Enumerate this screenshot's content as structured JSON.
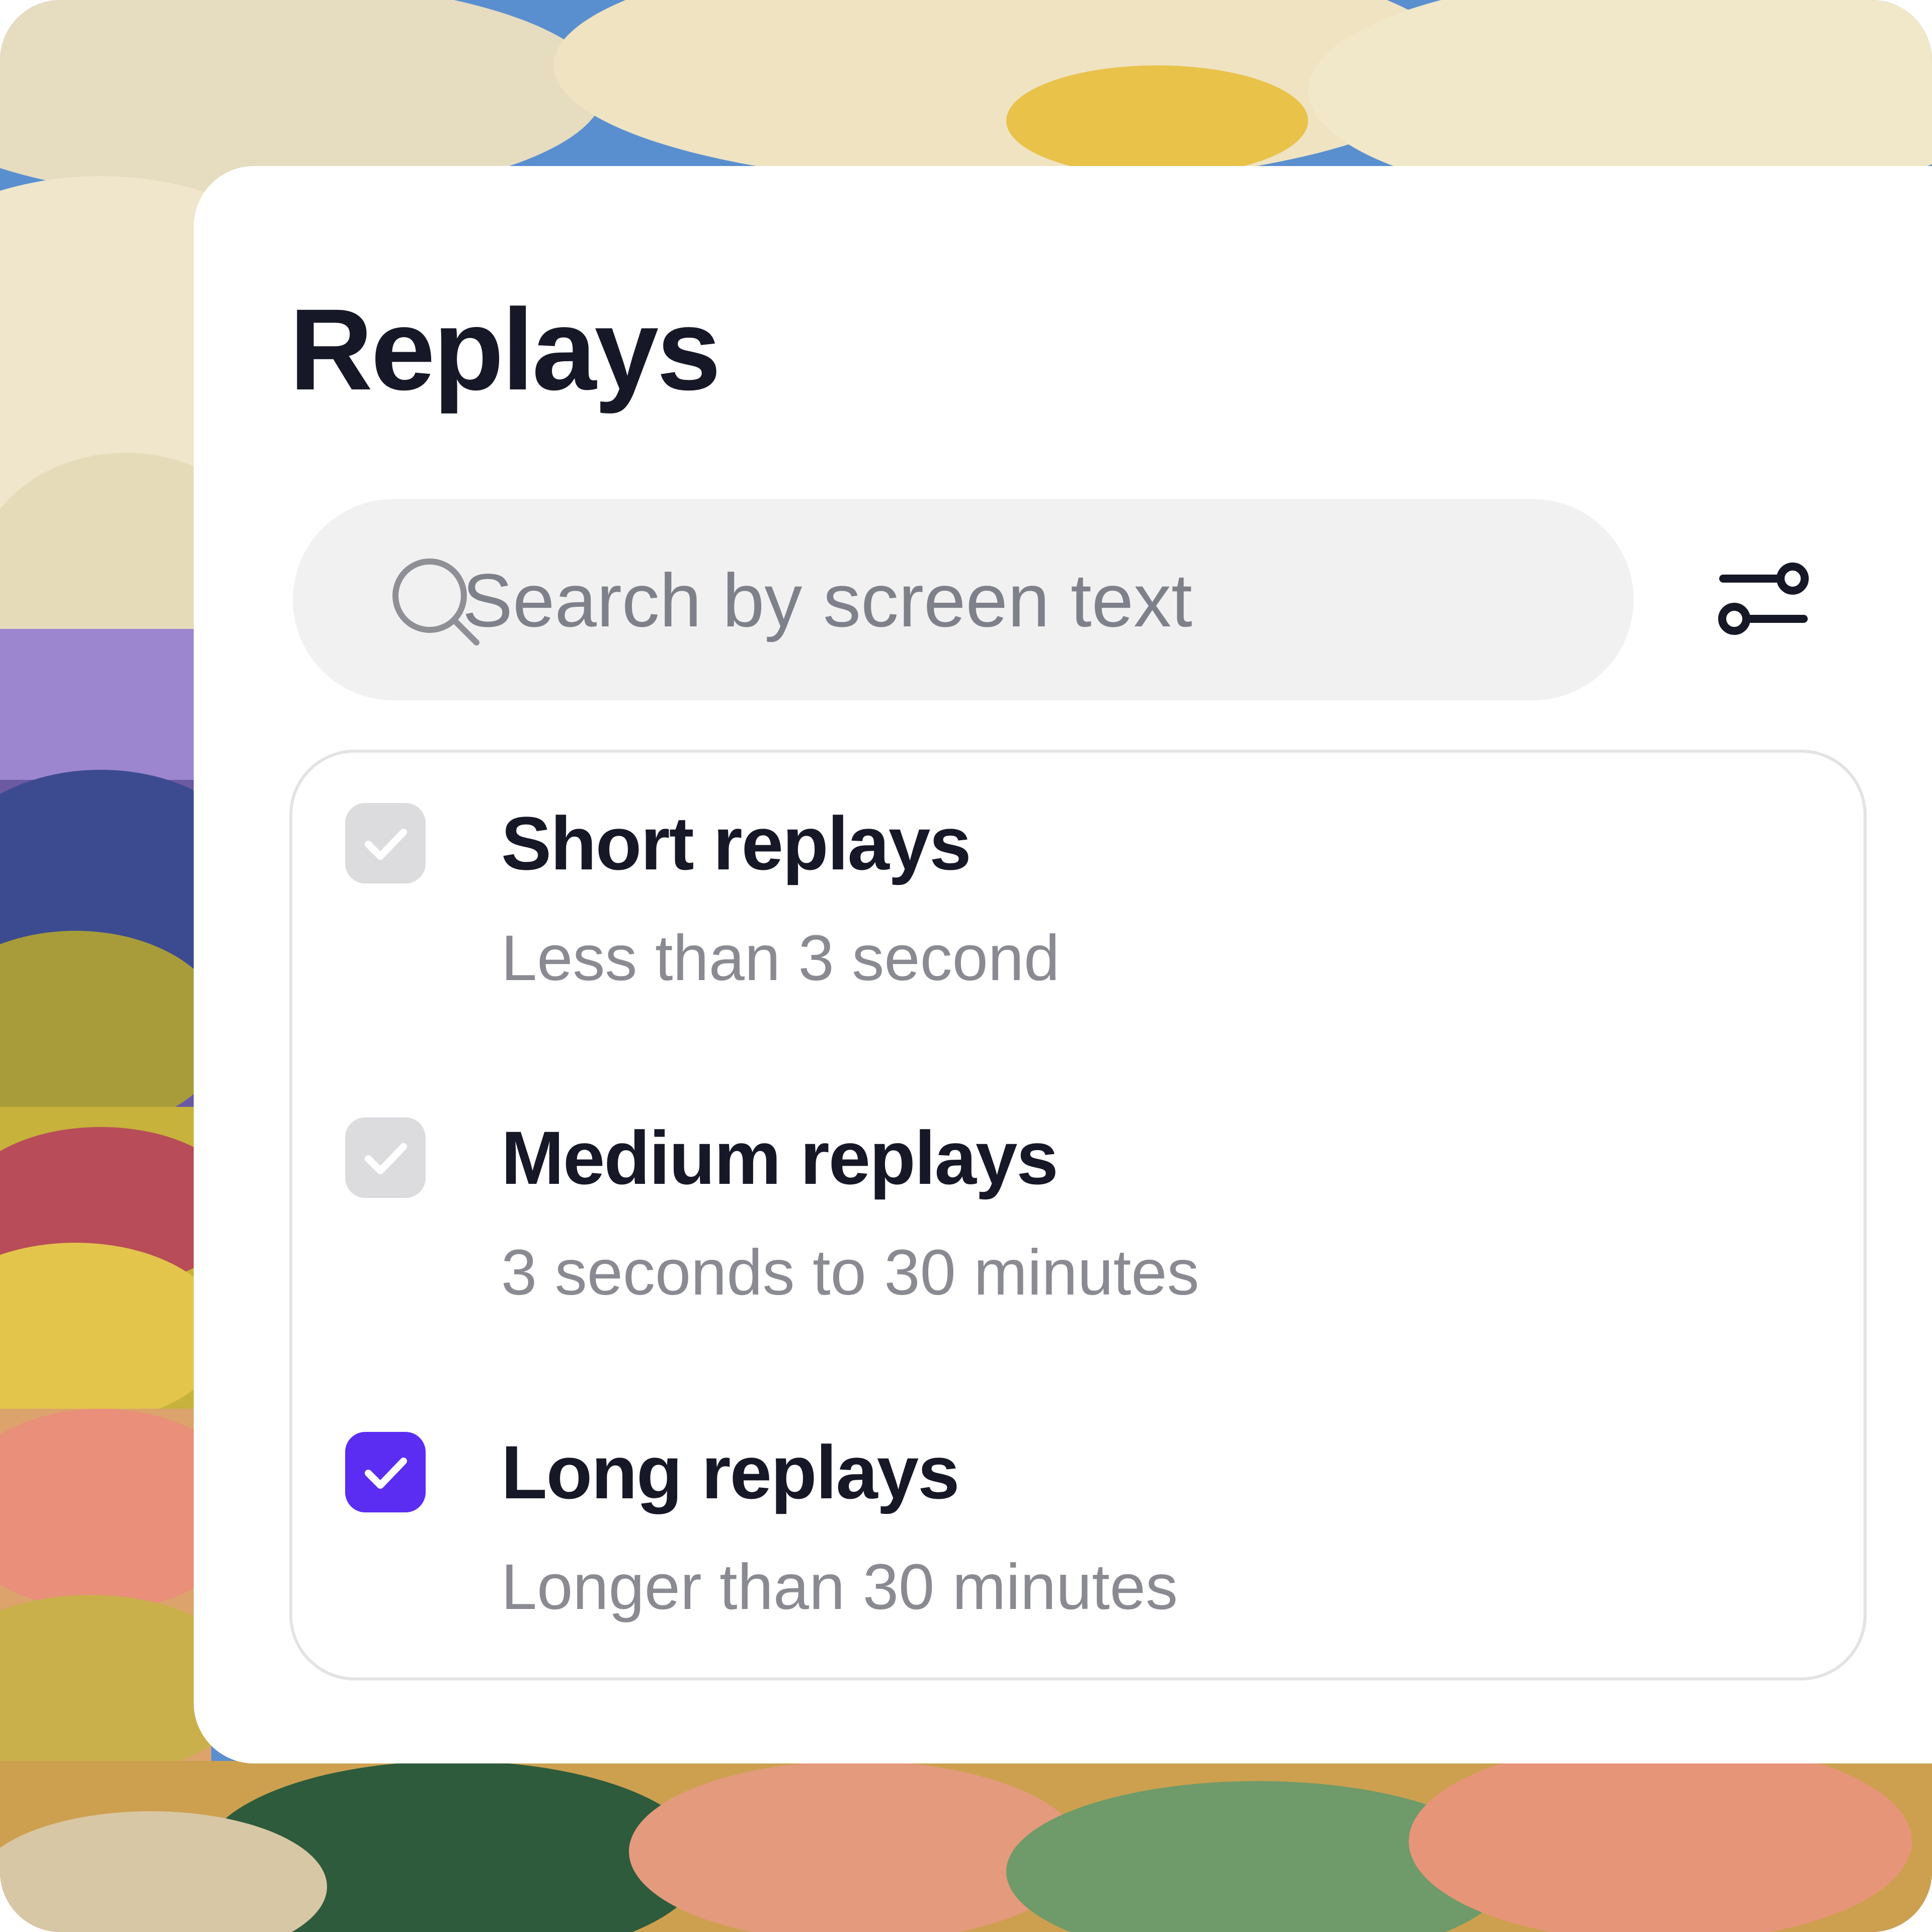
{
  "panel": {
    "title": "Replays"
  },
  "search": {
    "placeholder": "Search by screen text",
    "icon": "search-icon"
  },
  "filter_button": {
    "icon": "sliders-icon"
  },
  "options": [
    {
      "title": "Short replays",
      "subtitle": "Less than 3 second",
      "checked": false
    },
    {
      "title": "Medium replays",
      "subtitle": "3 seconds to 30 minutes",
      "checked": false
    },
    {
      "title": "Long replays",
      "subtitle": "Longer than 30 minutes",
      "checked": true
    }
  ],
  "colors": {
    "accent": "#5b2df2",
    "title_text": "#171827",
    "muted_text": "#8a8b92",
    "search_bg": "#f1f1f2",
    "unchecked_box": "#dcdcdf"
  }
}
